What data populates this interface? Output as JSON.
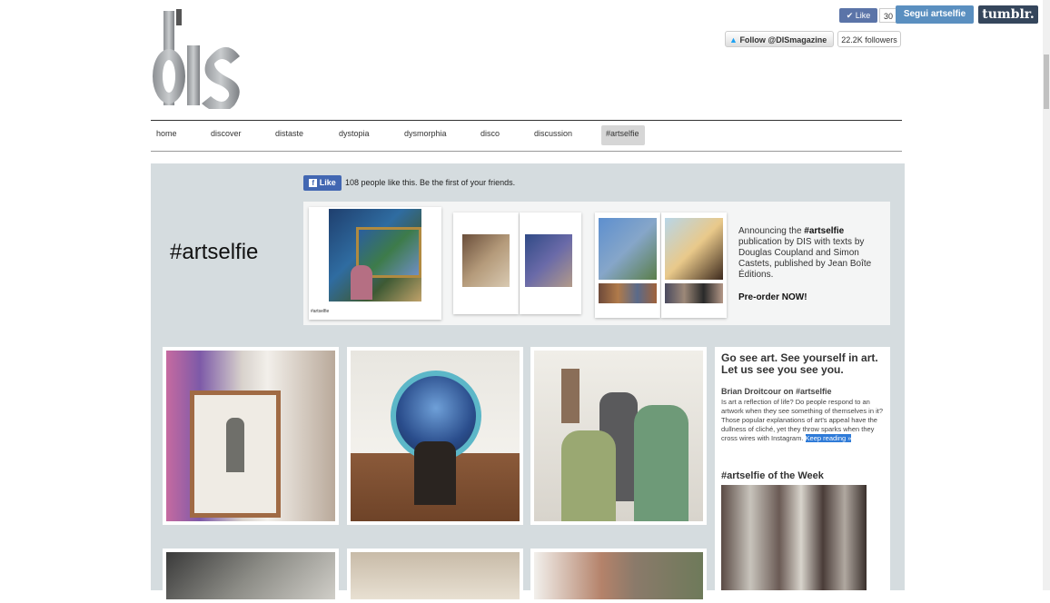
{
  "logo": {
    "text": "dis"
  },
  "social": {
    "fb_like_label": "Like",
    "fb_like_count": "30",
    "tumblr_follow": "Segui artselfie",
    "tumblr_logo": "tumblr.",
    "twitter_follow": "Follow @DISmagazine",
    "twitter_followers": "22.2K followers"
  },
  "nav": {
    "items": [
      "home",
      "discover",
      "distaste",
      "dystopia",
      "dysmorphia",
      "disco",
      "discussion",
      "#artselfie"
    ],
    "active": "#artselfie"
  },
  "fb_bar": {
    "like_label": "Like",
    "text": "108 people like this. Be the first of your friends."
  },
  "page_title": "#artselfie",
  "banner": {
    "announce_pre": "Announcing the ",
    "announce_tag": "#artselfie",
    "announce_rest": " publication by DIS with texts by Douglas Coupland and Simon Castets, published by Jean Boîte Éditions.",
    "preorder": "Pre-order NOW!",
    "card_caption": "#artselfie"
  },
  "sidebar": {
    "headline": "Go see art. See yourself in art. Let us see you see you.",
    "author": "Brian Droitcour on #artselfie",
    "blurb": "Is art a reflection of life? Do people respond to an artwork when they see something of themselves in it? Those popular explanations of art's appeal have the dullness of cliché, yet they throw sparks when they cross wires with Instagram.",
    "keep_reading": "Keep reading »",
    "week_title": "#artselfie of the Week"
  },
  "colors": {
    "panel_bg": "#d5dcdf",
    "fb_blue": "#4267b2",
    "tumblr_blue": "#35465c",
    "link_highlight": "#2f7bd8"
  }
}
